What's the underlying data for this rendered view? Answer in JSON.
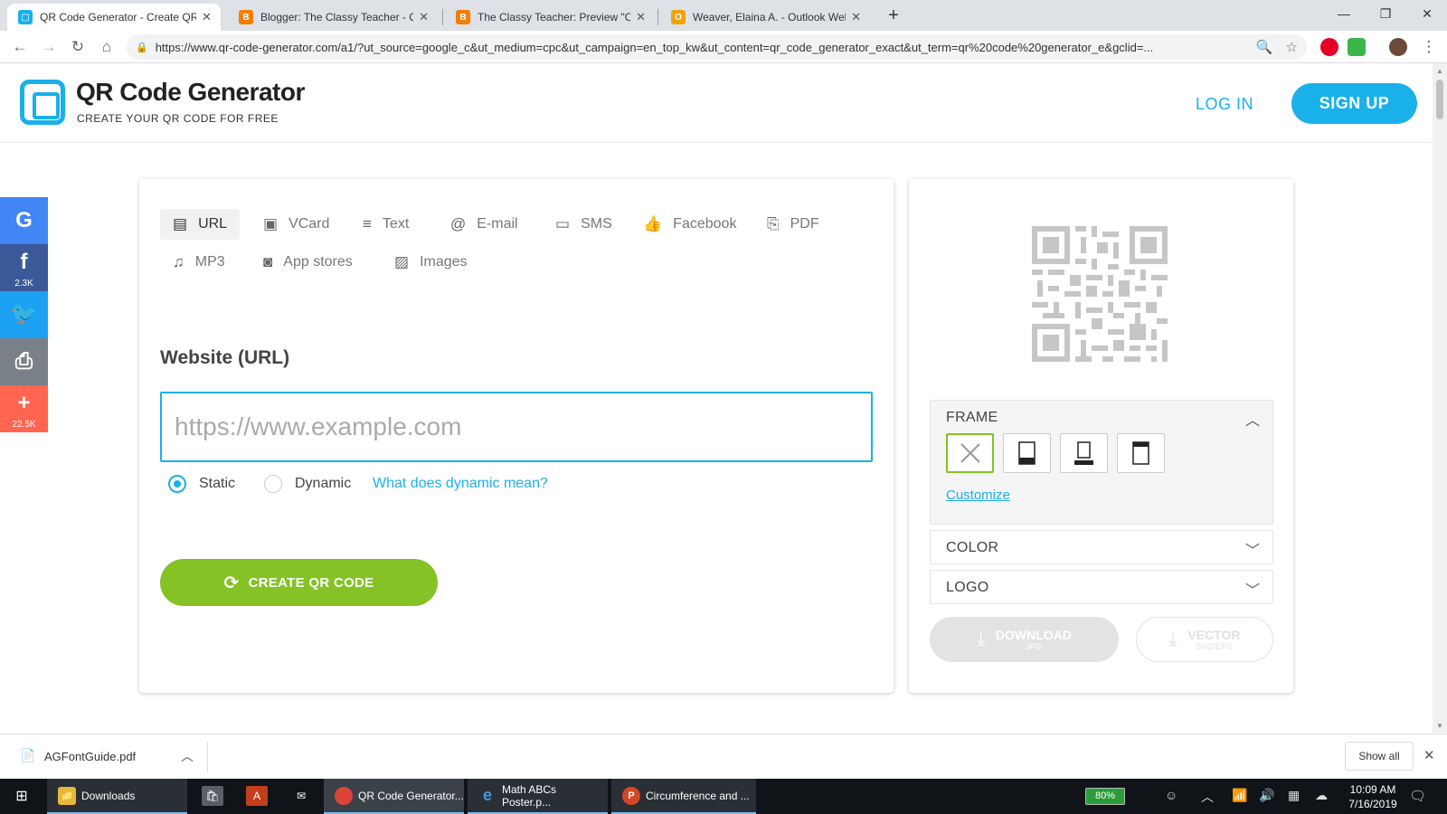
{
  "browser": {
    "tabs": [
      {
        "title": "QR Code Generator - Create QR Codes",
        "favicon": "qr",
        "active": true
      },
      {
        "title": "Blogger: The Classy Teacher - Create post",
        "favicon": "B"
      },
      {
        "title": "The Classy Teacher: Preview \"Create\"",
        "favicon": "B"
      },
      {
        "title": "Weaver, Elaina A. - Outlook Web App",
        "favicon": "O"
      }
    ],
    "new_tab_icon": "+",
    "window_controls": {
      "minimize": "—",
      "restore": "❐",
      "close": "✕"
    },
    "url": "https://www.qr-code-generator.com/a1/?ut_source=google_c&ut_medium=cpc&ut_campaign=en_top_kw&ut_content=qr_code_generator_exact&ut_term=qr%20code%20generator_e&gclid=..."
  },
  "header": {
    "brand_title": "QR Code Generator",
    "brand_tagline": "CREATE YOUR QR CODE FOR FREE",
    "login": "LOG IN",
    "signup": "SIGN UP"
  },
  "share": [
    {
      "icon": "G",
      "color": "#4285f4"
    },
    {
      "icon": "f",
      "color": "#3b5998",
      "count": "2.3K"
    },
    {
      "icon": "🐦",
      "color": "#1da1f2"
    },
    {
      "icon": "⎙",
      "color": "#7a8087"
    },
    {
      "icon": "+",
      "color": "#ff6550",
      "count": "22.5K"
    }
  ],
  "types": [
    {
      "label": "URL",
      "icon": "▤"
    },
    {
      "label": "VCard",
      "icon": "▣"
    },
    {
      "label": "Text",
      "icon": "≡"
    },
    {
      "label": "E-mail",
      "icon": "@"
    },
    {
      "label": "SMS",
      "icon": "▭"
    },
    {
      "label": "Facebook",
      "icon": "👍"
    },
    {
      "label": "PDF",
      "icon": "⎘"
    },
    {
      "label": "MP3",
      "icon": "♫"
    },
    {
      "label": "App stores",
      "icon": "◙"
    },
    {
      "label": "Images",
      "icon": "▨"
    }
  ],
  "form": {
    "heading": "Website (URL)",
    "placeholder": "https://www.example.com",
    "value": "",
    "static_label": "Static",
    "dynamic_label": "Dynamic",
    "dynamic_link": "What does dynamic mean?",
    "create_label": "CREATE QR CODE"
  },
  "sidepanel": {
    "frame_title": "FRAME",
    "customize": "Customize",
    "color_title": "COLOR",
    "logo_title": "LOGO",
    "download_label": "DOWNLOAD",
    "download_sub": "JPG",
    "vector_label": "VECTOR",
    "vector_sub": "SVG/EPS"
  },
  "shelf": {
    "filename": "AGFontGuide.pdf",
    "show_all": "Show all"
  },
  "taskbar": {
    "items": [
      {
        "label": "Downloads",
        "icon": "📁"
      },
      {
        "label": "QR Code Generator...",
        "icon": "◉"
      },
      {
        "label": "Math ABCs Poster.p...",
        "icon": "e"
      },
      {
        "label": "Circumference and ...",
        "icon": "P"
      }
    ],
    "battery": "80%",
    "time": "10:09 AM",
    "date": "7/16/2019"
  }
}
